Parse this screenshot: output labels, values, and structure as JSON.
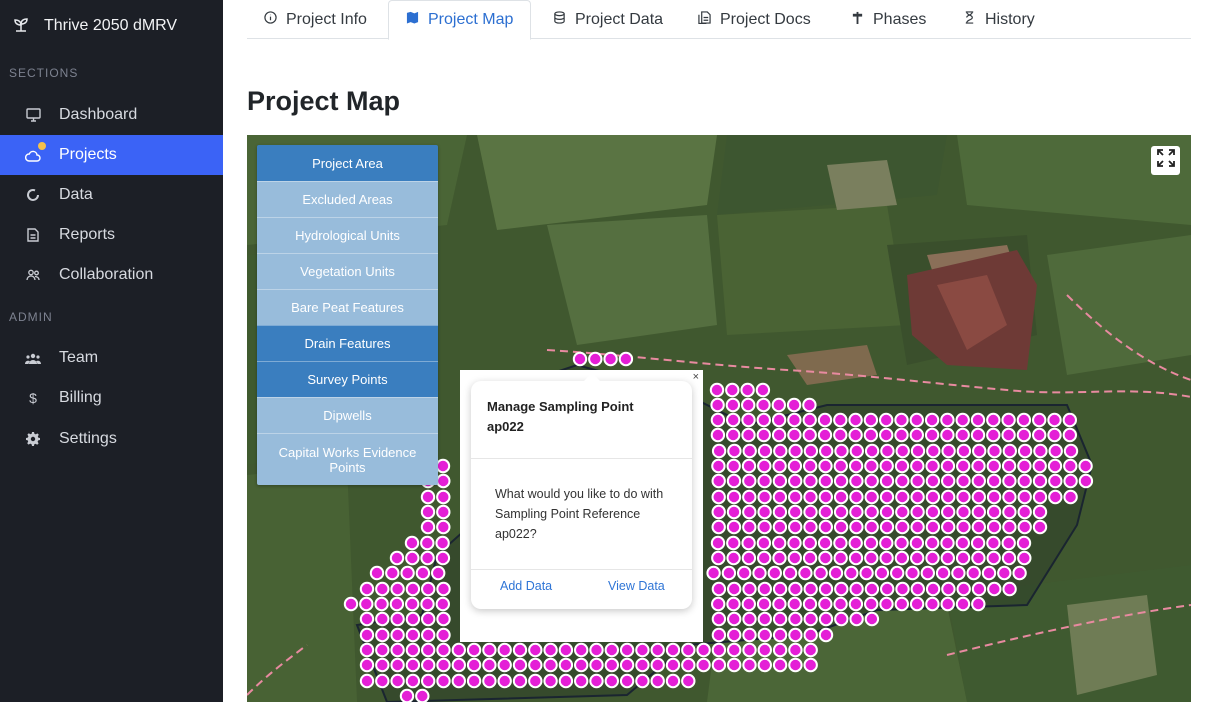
{
  "app": {
    "title": "Thrive 2050 dMRV"
  },
  "sidebar": {
    "sections_label": "SECTIONS",
    "admin_label": "ADMIN",
    "items": [
      {
        "label": "Dashboard",
        "icon": "monitor-icon"
      },
      {
        "label": "Projects",
        "icon": "cloud-icon",
        "active": true
      },
      {
        "label": "Data",
        "icon": "circle-icon"
      },
      {
        "label": "Reports",
        "icon": "document-icon"
      },
      {
        "label": "Collaboration",
        "icon": "users-icon"
      }
    ],
    "admin_items": [
      {
        "label": "Team",
        "icon": "team-icon"
      },
      {
        "label": "Billing",
        "icon": "dollar-icon"
      },
      {
        "label": "Settings",
        "icon": "gear-icon"
      }
    ]
  },
  "tabs": [
    {
      "label": "Project Info",
      "icon": "info-icon"
    },
    {
      "label": "Project Map",
      "icon": "map-icon",
      "active": true
    },
    {
      "label": "Project Data",
      "icon": "database-icon"
    },
    {
      "label": "Project Docs",
      "icon": "docs-icon"
    },
    {
      "label": "Phases",
      "icon": "signpost-icon"
    },
    {
      "label": "History",
      "icon": "hourglass-icon"
    }
  ],
  "page": {
    "title": "Project Map"
  },
  "map": {
    "layers": [
      {
        "label": "Project Area",
        "on": true
      },
      {
        "label": "Excluded Areas",
        "on": false
      },
      {
        "label": "Hydrological Units",
        "on": false
      },
      {
        "label": "Vegetation Units",
        "on": false
      },
      {
        "label": "Bare Peat Features",
        "on": false
      },
      {
        "label": "Drain Features",
        "on": true
      },
      {
        "label": "Survey Points",
        "on": true
      },
      {
        "label": "Dipwells",
        "on": false
      },
      {
        "label": "Capital Works Evidence Points",
        "on": false
      }
    ],
    "popup": {
      "close": "×",
      "title": "Manage Sampling Point ap022",
      "body": "What would you like to do with Sampling Point Reference ap022?",
      "add_label": "Add Data",
      "view_label": "View Data"
    },
    "colors": {
      "point_fill": "#e41fd6",
      "layer_on": "#3a7ebf",
      "layer_off": "#98bcdb",
      "active_nav": "#3b63f6"
    }
  }
}
